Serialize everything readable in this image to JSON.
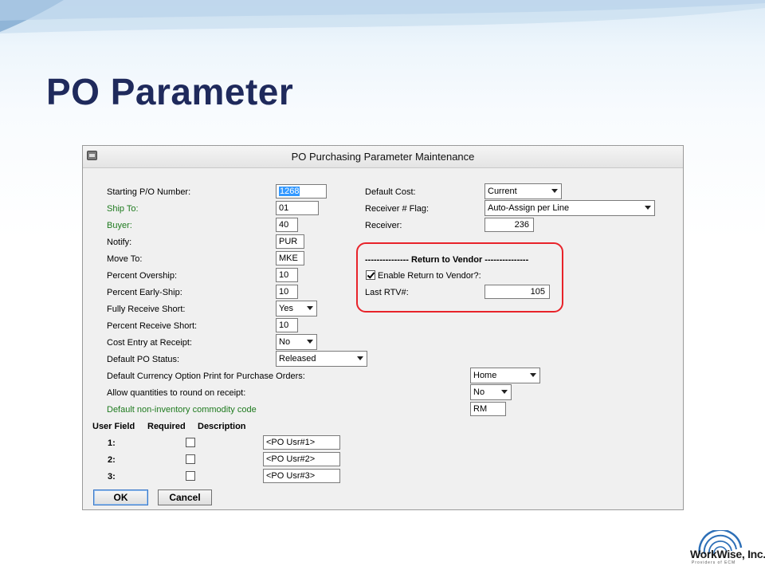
{
  "slide": {
    "title": "PO Parameter"
  },
  "window": {
    "title": "PO Purchasing Parameter Maintenance"
  },
  "left_fields": {
    "starting_po_label": "Starting P/O Number:",
    "starting_po_value": "1268",
    "ship_to_label": "Ship To:",
    "ship_to_value": "01",
    "buyer_label": "Buyer:",
    "buyer_value": "40",
    "notify_label": "Notify:",
    "notify_value": "PUR",
    "move_to_label": "Move To:",
    "move_to_value": "MKE",
    "pct_overship_label": "Percent Overship:",
    "pct_overship_value": "10",
    "pct_earlyship_label": "Percent Early-Ship:",
    "pct_earlyship_value": "10",
    "fully_receive_label": "Fully Receive Short:",
    "fully_receive_value": "Yes",
    "pct_receive_short_label": "Percent Receive Short:",
    "pct_receive_short_value": "10",
    "cost_entry_label": "Cost Entry at Receipt:",
    "cost_entry_value": "No",
    "default_status_label": "Default PO Status:",
    "default_status_value": "Released",
    "currency_label": "Default Currency Option Print for Purchase Orders:",
    "currency_value": "Home",
    "round_label": "Allow quantities to round on receipt:",
    "round_value": "No",
    "commodity_label": "Default non-inventory commodity code",
    "commodity_value": "RM"
  },
  "right_fields": {
    "default_cost_label": "Default Cost:",
    "default_cost_value": "Current",
    "receiver_flag_label": "Receiver # Flag:",
    "receiver_flag_value": "Auto-Assign per Line",
    "receiver_label": "Receiver:",
    "receiver_value": "236",
    "rtv_header": "--------------- Return to Vendor ---------------",
    "enable_rtv_label": "Enable Return to Vendor?:",
    "enable_rtv_checked": true,
    "last_rtv_label": "Last RTV#:",
    "last_rtv_value": "105"
  },
  "user_fields": {
    "header_field": "User Field",
    "header_required": "Required",
    "header_description": "Description",
    "rows": [
      {
        "num": "1:",
        "required": false,
        "description": "<PO Usr#1>"
      },
      {
        "num": "2:",
        "required": false,
        "description": "<PO Usr#2>"
      },
      {
        "num": "3:",
        "required": false,
        "description": "<PO Usr#3>"
      }
    ]
  },
  "buttons": {
    "ok": "OK",
    "cancel": "Cancel"
  },
  "logo": {
    "name": "WorkWise, Inc.",
    "tagline": "Providers of ECM"
  },
  "colors": {
    "title": "#1f2a5c",
    "highlight": "#e8232a",
    "green_label": "#1e7a1e"
  }
}
